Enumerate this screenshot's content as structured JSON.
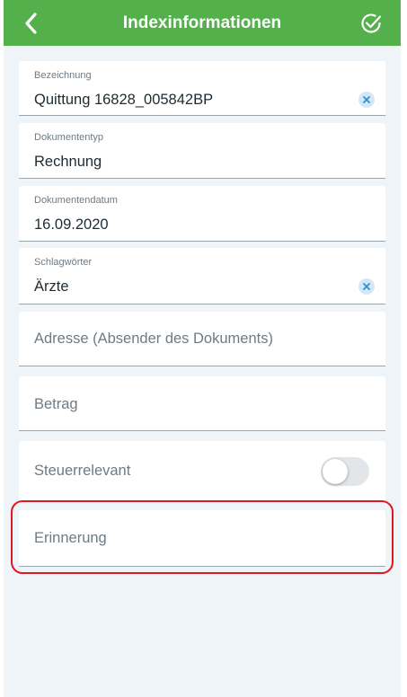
{
  "navbar": {
    "title": "Indexinformationen",
    "back_icon": "chevron-left-icon",
    "done_icon": "check-circle-icon",
    "color": "#53b04b"
  },
  "fields": {
    "bezeichnung": {
      "label": "Bezeichnung",
      "value": "Quittung 16828_005842BP"
    },
    "dokumententyp": {
      "label": "Dokumententyp",
      "value": "Rechnung"
    },
    "dokumentendatum": {
      "label": "Dokumentendatum",
      "value": "16.09.2020"
    },
    "schlagwoerter": {
      "label": "Schlagwörter",
      "value": "Ärzte"
    },
    "adresse": {
      "placeholder": "Adresse (Absender des Dokuments)"
    },
    "betrag": {
      "placeholder": "Betrag"
    },
    "steuerrelevant": {
      "label": "Steuerrelevant",
      "on": false
    },
    "erinnerung": {
      "placeholder": "Erinnerung"
    }
  },
  "highlight_color": "#dd1a22"
}
